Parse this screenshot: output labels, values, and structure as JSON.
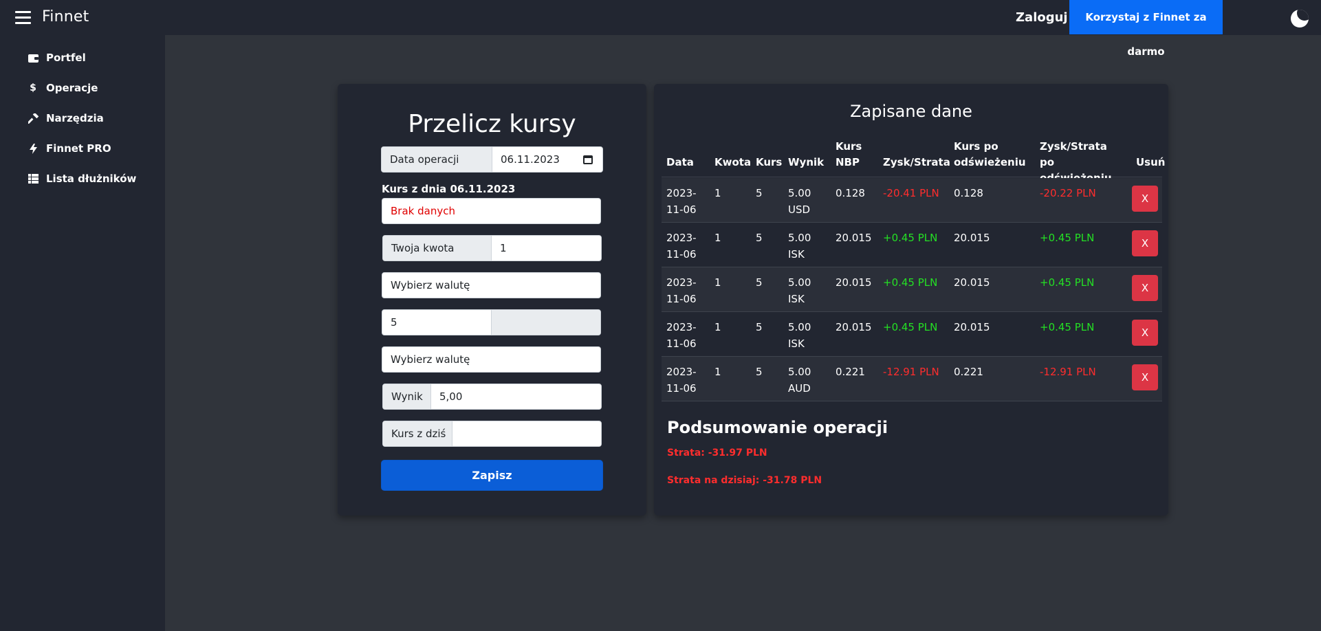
{
  "header": {
    "brand": "Finnet",
    "login_label": "Zaloguj",
    "cta_label": "Korzystaj z Finnet za darmo",
    "menu_icon": "hamburger-icon",
    "theme_icon": "moon-icon"
  },
  "sidebar": {
    "items": [
      {
        "label": "Portfel",
        "icon": "wallet-icon"
      },
      {
        "label": "Operacje",
        "icon": "dollar-icon"
      },
      {
        "label": "Narzędzia",
        "icon": "hammer-icon"
      },
      {
        "label": "Finnet PRO",
        "icon": "lightning-icon"
      },
      {
        "label": "Lista dłużników",
        "icon": "list-icon"
      }
    ]
  },
  "converter": {
    "title": "Przelicz kursy",
    "date_label": "Data operacji",
    "date_value": "06.11.2023",
    "rate_date_label": "Kurs z dnia 06.11.2023",
    "rate_status": "Brak danych",
    "amount_label": "Twoja kwota",
    "amount_value": "1",
    "currency_from": "Wybierz walutę",
    "rate_value": "5",
    "currency_to": "Wybierz walutę",
    "result_label": "Wynik",
    "result_value": "5,00",
    "today_rate_label": "Kurs z dziś",
    "today_rate_value": "",
    "save_label": "Zapisz"
  },
  "saved": {
    "title": "Zapisane dane",
    "columns": [
      "Data",
      "Kwota",
      "Kurs",
      "Wynik",
      "Kurs NBP",
      "Zysk/Strata",
      "Kurs po odświeżeniu",
      "Zysk/Strata po odświeżeniu",
      "Usuń"
    ],
    "rows": [
      {
        "date": "2023-11-06",
        "amount": "1",
        "rate": "5",
        "result": "5.00 USD",
        "nbp": "0.128",
        "pl": "-20.41 PLN",
        "rate_refresh": "0.128",
        "pl_refresh": "-20.22 PLN",
        "delete": "X"
      },
      {
        "date": "2023-11-06",
        "amount": "1",
        "rate": "5",
        "result": "5.00 ISK",
        "nbp": "20.015",
        "pl": "+0.45 PLN",
        "rate_refresh": "20.015",
        "pl_refresh": "+0.45 PLN",
        "delete": "X"
      },
      {
        "date": "2023-11-06",
        "amount": "1",
        "rate": "5",
        "result": "5.00 ISK",
        "nbp": "20.015",
        "pl": "+0.45 PLN",
        "rate_refresh": "20.015",
        "pl_refresh": "+0.45 PLN",
        "delete": "X"
      },
      {
        "date": "2023-11-06",
        "amount": "1",
        "rate": "5",
        "result": "5.00 ISK",
        "nbp": "20.015",
        "pl": "+0.45 PLN",
        "rate_refresh": "20.015",
        "pl_refresh": "+0.45 PLN",
        "delete": "X"
      },
      {
        "date": "2023-11-06",
        "amount": "1",
        "rate": "5",
        "result": "5.00 AUD",
        "nbp": "0.221",
        "pl": "-12.91 PLN",
        "rate_refresh": "0.221",
        "pl_refresh": "-12.91 PLN",
        "delete": "X"
      }
    ],
    "summary_title": "Podsumowanie operacji",
    "summary_loss": "Strata: -31.97 PLN",
    "summary_loss_today": "Strata na dzisiaj: -31.78 PLN"
  },
  "colors": {
    "background": "#30343b",
    "panel": "#222631",
    "accent": "#0a6cf6",
    "danger": "#dc3545",
    "profit": "#24e024",
    "loss": "#ff2d2d"
  }
}
